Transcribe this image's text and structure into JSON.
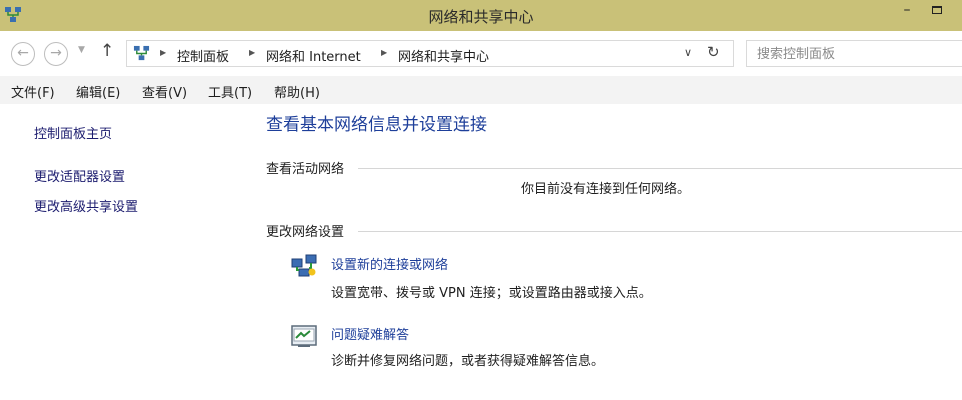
{
  "window": {
    "title": "网络和共享中心",
    "minimize_glyph": "–"
  },
  "nav": {
    "back_glyph": "←",
    "forward_glyph": "→",
    "recent_glyph": "▼",
    "up_glyph": "↑",
    "breadcrumbs": [
      "控制面板",
      "网络和 Internet",
      "网络和共享中心"
    ],
    "separator_glyph": "▶",
    "dropdown_glyph": "∨",
    "refresh_glyph": "↻",
    "search_placeholder": "搜索控制面板"
  },
  "menu": {
    "items": [
      "文件(F)",
      "编辑(E)",
      "查看(V)",
      "工具(T)",
      "帮助(H)"
    ]
  },
  "sidebar": {
    "links": [
      "控制面板主页",
      "更改适配器设置",
      "更改高级共享设置"
    ]
  },
  "main": {
    "title": "查看基本网络信息并设置连接",
    "active_networks": {
      "heading": "查看活动网络",
      "status": "你目前没有连接到任何网络。"
    },
    "change_settings": {
      "heading": "更改网络设置",
      "tasks": [
        {
          "icon": "network-setup-icon",
          "link": "设置新的连接或网络",
          "description": "设置宽带、拨号或 VPN 连接；或设置路由器或接入点。"
        },
        {
          "icon": "troubleshoot-icon",
          "link": "问题疑难解答",
          "description": "诊断并修复网络问题，或者获得疑难解答信息。"
        }
      ]
    }
  },
  "colors": {
    "titlebar": "#c9c178",
    "link": "#1e3f9a",
    "sidebar_link": "#1b1b6e",
    "menubar": "#f3f3f3"
  }
}
